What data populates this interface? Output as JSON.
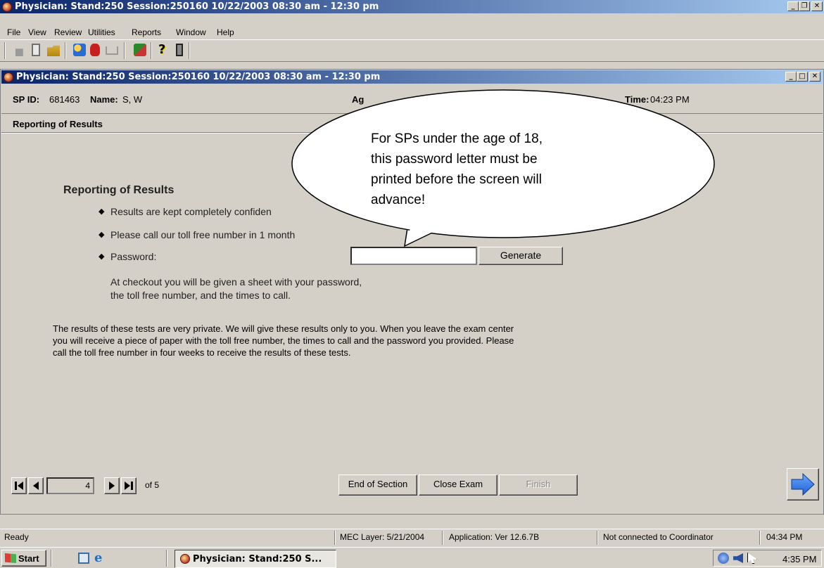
{
  "outer_window": {
    "title": "Physician: Stand:250 Session:250160 10/22/2003 08:30 am - 12:30 pm"
  },
  "menu": [
    "File",
    "View",
    "Review",
    "Utilities",
    "Reports",
    "Window",
    "Help"
  ],
  "inner_window": {
    "title": "Physician: Stand:250 Session:250160 10/22/2003 08:30 am - 12:30 pm"
  },
  "info_bar": {
    "sp_id_label": "SP ID:",
    "sp_id_value": "681463",
    "name_label": "Name:",
    "name_value": "S, W",
    "age_label": "Ag",
    "time_label": "Time:",
    "time_value": "04:23 PM"
  },
  "section_header": "Reporting of Results",
  "content": {
    "heading": "Reporting of Results",
    "bullet1": "Results are kept completely confiden",
    "bullet2": "Please call our toll free number in 1 month",
    "password_label": "Password:",
    "password_value": "",
    "generate_label": "Generate",
    "checkout_line1": "At checkout you will be given a sheet with your password,",
    "checkout_line2": "the toll free number, and the times to call.",
    "para_line1": "The results of these tests are very private.  We will give these results only to you. When you leave the exam center",
    "para_line2": "you will receive a piece of paper with the toll free number, the times to call and the password you provided. Please",
    "para_line3": "call the toll free number in four weeks to receive the results of these tests."
  },
  "callout": {
    "line1": "For SPs under the age of 18,",
    "line2": "this password letter must be",
    "line3": "printed before the screen will",
    "line4": "advance!"
  },
  "nav": {
    "page": "4",
    "of_label": "of 5",
    "end_section": "End of Section",
    "close_exam": "Close Exam",
    "finish": "Finish"
  },
  "status": {
    "ready": "Ready",
    "mec_layer": "MEC Layer: 5/21/2004",
    "application": "Application: Ver 12.6.7B",
    "coordinator": "Not connected to Coordinator",
    "time": "04:34 PM"
  },
  "taskbar": {
    "start": "Start",
    "task": "Physician: Stand:250 S...",
    "clock": "4:35 PM"
  },
  "colors": {
    "titlebar": "#0a246a",
    "face": "#d4d0c8",
    "taskbar_arrow": "#1f5fd0"
  }
}
